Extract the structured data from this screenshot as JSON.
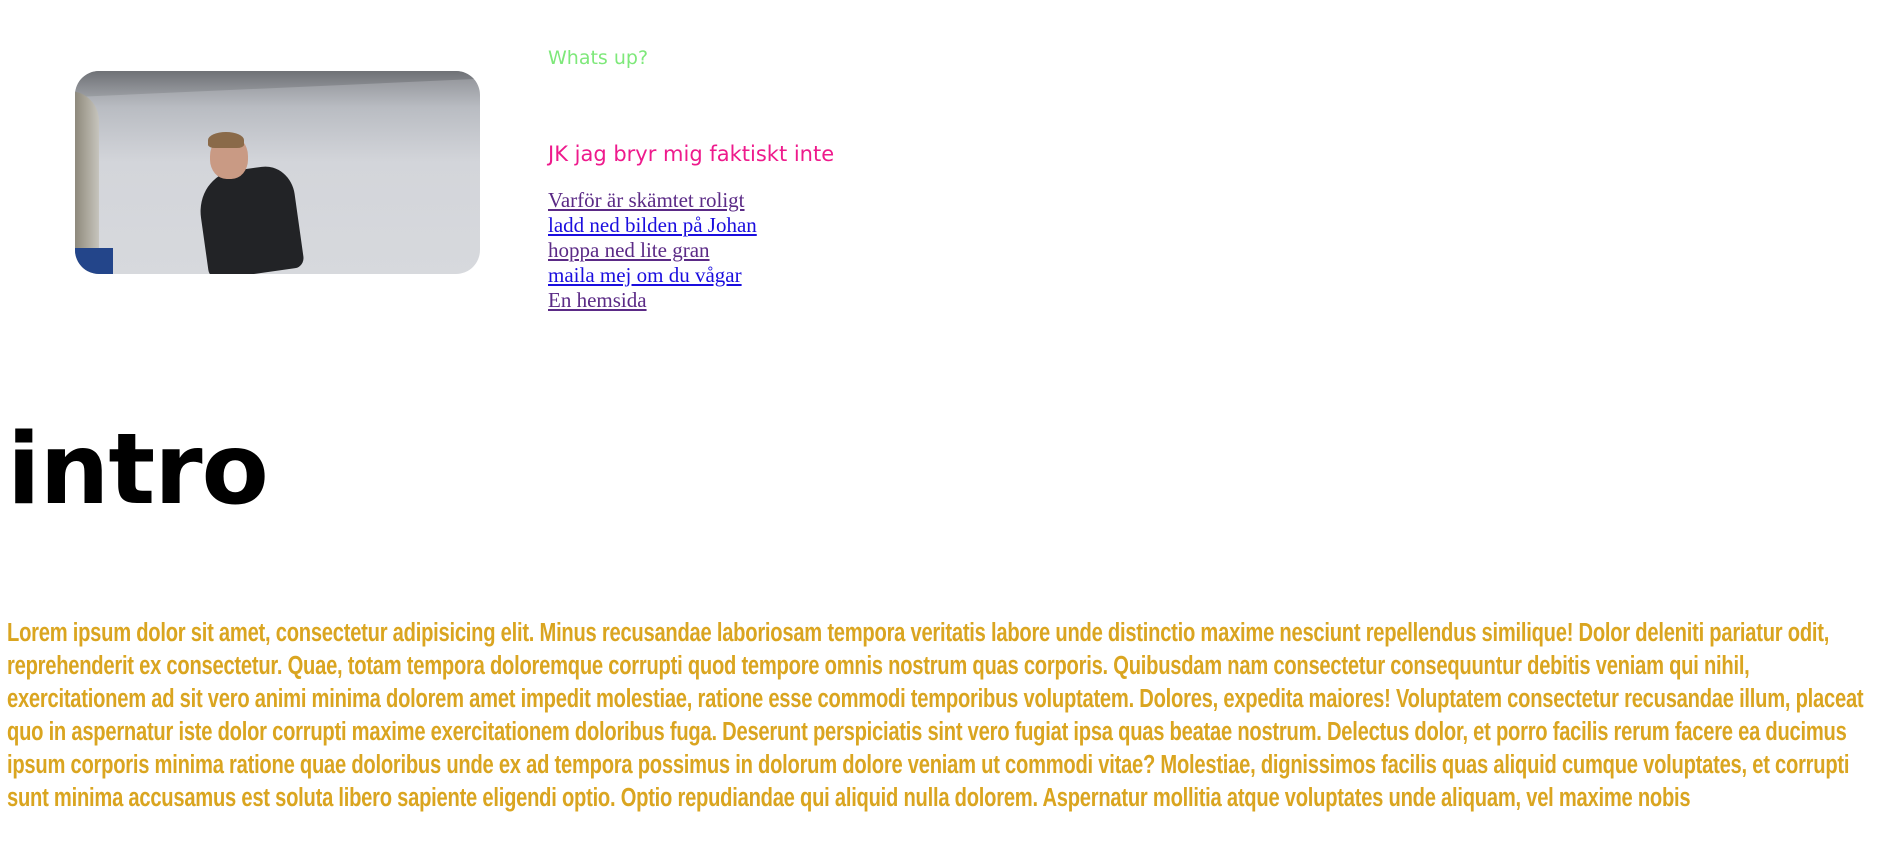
{
  "greeting": "Whats up?",
  "tagline": "JK jag bryr mig faktiskt inte",
  "links": [
    {
      "label": "Varför är skämtet roligt",
      "state": "visited"
    },
    {
      "label": "ladd ned bilden på Johan",
      "state": "unvisited"
    },
    {
      "label": "hoppa ned lite gran",
      "state": "visited"
    },
    {
      "label": "maila mej om du vågar",
      "state": "unvisited"
    },
    {
      "label": "En hemsida",
      "state": "visited"
    }
  ],
  "intro": {
    "title": "intro",
    "body": "Lorem ipsum dolor sit amet, consectetur adipisicing elit. Minus recusandae laboriosam tempora veritatis labore unde distinctio maxime nesciunt repellendus similique! Dolor deleniti pariatur odit, reprehenderit ex consectetur. Quae, totam tempora doloremque corrupti quod tempore omnis nostrum quas corporis. Quibusdam nam consectetur consequuntur debitis veniam qui nihil, exercitationem ad sit vero animi minima dolorem amet impedit molestiae, ratione esse commodi temporibus voluptatem. Dolores, expedita maiores! Voluptatem consectetur recusandae illum, placeat quo in aspernatur iste dolor corrupti maxime exercitationem doloribus fuga. Deserunt perspiciatis sint vero fugiat ipsa quas beatae nostrum. Delectus dolor, et porro facilis rerum facere ea ducimus ipsum corporis minima ratione quae doloribus unde ex ad tempora possimus in dolorum dolore veniam ut commodi vitae? Molestiae, dignissimos facilis quas aliquid cumque voluptates, et corrupti sunt minima accusamus est soluta libero sapiente eligendi optio. Optio repudiandae qui aliquid nulla dolorem. Aspernatur mollitia atque voluptates unde aliquam, vel maxime nobis"
  },
  "colors": {
    "greeting": "#7ee87a",
    "tagline": "#ee1a8c",
    "visited_link": "#5b2a86",
    "unvisited_link": "#1a0dde",
    "intro_body": "#daa520"
  }
}
